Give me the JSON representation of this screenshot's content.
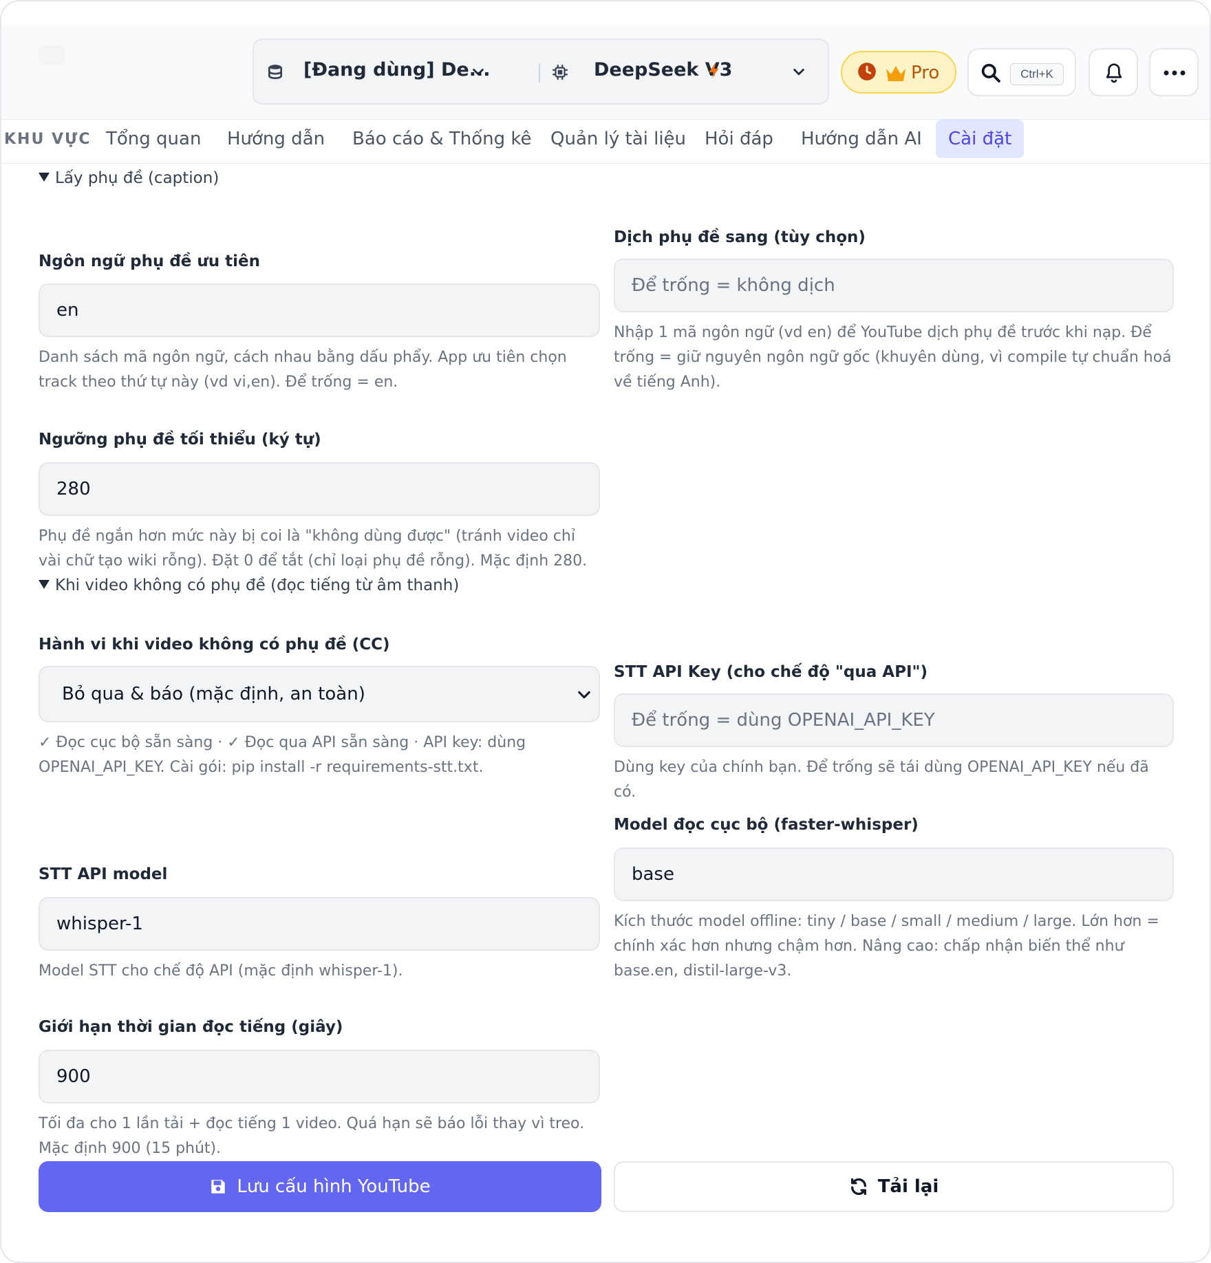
{
  "header": {
    "workspace_selector": {
      "label": "[Đang dùng] De...",
      "icon": "database-icon"
    },
    "model_selector": {
      "label": "DeepSeek V3",
      "icon": "chip-icon",
      "badge_icon": "lightning-icon"
    },
    "pro_button": {
      "label": "Pro",
      "icons": [
        "clock-icon",
        "crown-icon"
      ]
    },
    "search": {
      "shortcut": "Ctrl+K",
      "icon": "search-icon"
    },
    "notifications_icon": "bell-icon",
    "more_icon": "more-icon"
  },
  "tabs": {
    "area_label": "KHU VỰC",
    "items": [
      {
        "label": "Tổng quan",
        "active": false
      },
      {
        "label": "Hướng dẫn",
        "active": false
      },
      {
        "label": "Báo cáo & Thống kê",
        "active": false
      },
      {
        "label": "Quản lý tài liệu",
        "active": false
      },
      {
        "label": "Hỏi đáp",
        "active": false
      },
      {
        "label": "Hướng dẫn AI",
        "active": false
      },
      {
        "label": "Cài đặt",
        "active": true
      }
    ]
  },
  "captions_section": {
    "title": "Lấy phụ đề (caption)",
    "preferred_lang": {
      "label": "Ngôn ngữ phụ đề ưu tiên",
      "value": "en",
      "help": "Danh sách mã ngôn ngữ, cách nhau bằng dấu phẩy. App ưu tiên chọn track theo thứ tự này (vd vi,en). Để trống = en."
    },
    "translate_to": {
      "label": "Dịch phụ đề sang (tùy chọn)",
      "placeholder": "Để trống = không dịch",
      "help": "Nhập 1 mã ngôn ngữ (vd en) để YouTube dịch phụ đề trước khi nạp. Để trống = giữ nguyên ngôn ngữ gốc (khuyên dùng, vì compile tự chuẩn hoá về tiếng Anh)."
    },
    "min_length": {
      "label": "Ngưỡng phụ đề tối thiểu (ký tự)",
      "value": "280",
      "help": "Phụ đề ngắn hơn mức này bị coi là \"không dùng được\" (tránh video chỉ vài chữ tạo wiki rỗng). Đặt 0 để tắt (chỉ loại phụ đề rỗng). Mặc định 280."
    }
  },
  "stt_section": {
    "title": "Khi video không có phụ đề (đọc tiếng từ âm thanh)",
    "behavior": {
      "label": "Hành vi khi video không có phụ đề (CC)",
      "selected": "Bỏ qua & báo (mặc định, an toàn)",
      "help": "✓ Đọc cục bộ sẵn sàng · ✓ Đọc qua API sẵn sàng · API key: dùng OPENAI_API_KEY. Cài gói: pip install -r requirements-stt.txt."
    },
    "api_key": {
      "label": "STT API Key (cho chế độ \"qua API\")",
      "placeholder": "Để trống = dùng OPENAI_API_KEY",
      "help": "Dùng key của chính bạn. Để trống sẽ tái dùng OPENAI_API_KEY nếu đã có."
    },
    "local_model": {
      "label": "Model đọc cục bộ (faster-whisper)",
      "value": "base",
      "help": "Kích thước model offline: tiny / base / small / medium / large. Lớn hơn = chính xác hơn nhưng chậm hơn. Nâng cao: chấp nhận biến thể như base.en, distil-large-v3."
    },
    "api_model": {
      "label": "STT API model",
      "value": "whisper-1",
      "help": "Model STT cho chế độ API (mặc định whisper-1)."
    },
    "time_limit": {
      "label": "Giới hạn thời gian đọc tiếng (giây)",
      "value": "900",
      "help": "Tối đa cho 1 lần tải + đọc tiếng 1 video. Quá hạn sẽ báo lỗi thay vì treo. Mặc định 900 (15 phút)."
    }
  },
  "actions": {
    "save_label": "Lưu cấu hình YouTube",
    "save_icon": "floppy-disk-icon",
    "reload_label": "Tải lại",
    "reload_icon": "refresh-icon"
  },
  "colors": {
    "accent": "#6366f1",
    "tab_active_bg": "#e0e7ff",
    "tab_active_text": "#4f46e5",
    "pro_bg": "#fef3c7",
    "pro_border": "#fcd34d",
    "lightning": "#f97316"
  }
}
